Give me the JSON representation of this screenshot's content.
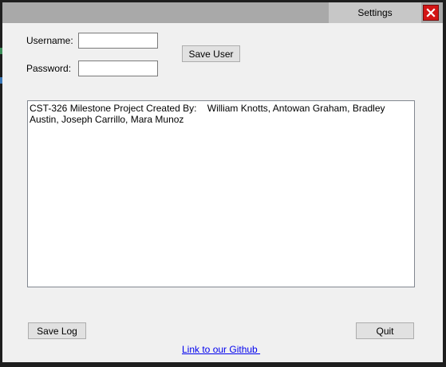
{
  "window": {
    "title": "Settings"
  },
  "user_form": {
    "username_label": "Username:",
    "username_value": "",
    "password_label": "Password:",
    "password_value": "",
    "save_user_label": "Save User"
  },
  "log": {
    "text": "CST-326 Milestone Project Created By:    William Knotts, Antowan Graham, Bradley Austin, Joseph Carrillo, Mara Munoz"
  },
  "footer": {
    "save_log_label": "Save Log",
    "quit_label": "Quit",
    "github_link_text": "Link to our Github "
  },
  "colors": {
    "close_button": "#d31515",
    "title_bar": "#a9a9a9",
    "title_tab": "#c7c7c7",
    "window_background": "#f0f0f0",
    "link": "#0000ee"
  },
  "icons": {
    "close": "close-icon"
  }
}
